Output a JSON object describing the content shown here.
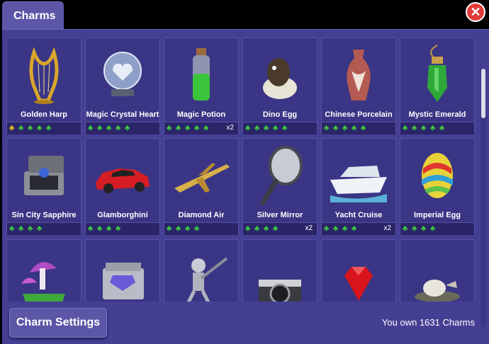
{
  "header": {
    "tab_label": "Charms",
    "close_icon": "close-icon"
  },
  "charms": [
    {
      "name": "Golden Harp",
      "clovers": 5,
      "gold": 1,
      "mult": ""
    },
    {
      "name": "Magic Crystal Heart",
      "clovers": 5,
      "gold": 0,
      "mult": ""
    },
    {
      "name": "Magic Potion",
      "clovers": 5,
      "gold": 0,
      "mult": "x2"
    },
    {
      "name": "Dino Egg",
      "clovers": 5,
      "gold": 0,
      "mult": ""
    },
    {
      "name": "Chinese Porcelain",
      "clovers": 5,
      "gold": 0,
      "mult": ""
    },
    {
      "name": "Mystic Emerald",
      "clovers": 5,
      "gold": 0,
      "mult": ""
    },
    {
      "name": "Sin City Sapphire",
      "clovers": 4,
      "gold": 0,
      "mult": ""
    },
    {
      "name": "Glamborghini",
      "clovers": 4,
      "gold": 0,
      "mult": ""
    },
    {
      "name": "Diamond Air",
      "clovers": 4,
      "gold": 0,
      "mult": ""
    },
    {
      "name": "Silver Mirror",
      "clovers": 4,
      "gold": 0,
      "mult": "x2"
    },
    {
      "name": "Yacht Cruise",
      "clovers": 4,
      "gold": 0,
      "mult": "x2"
    },
    {
      "name": "Imperial Egg",
      "clovers": 4,
      "gold": 0,
      "mult": ""
    },
    {
      "name": "",
      "clovers": 0,
      "gold": 0,
      "mult": ""
    },
    {
      "name": "",
      "clovers": 0,
      "gold": 0,
      "mult": ""
    },
    {
      "name": "",
      "clovers": 0,
      "gold": 0,
      "mult": ""
    },
    {
      "name": "",
      "clovers": 0,
      "gold": 0,
      "mult": ""
    },
    {
      "name": "",
      "clovers": 0,
      "gold": 0,
      "mult": ""
    },
    {
      "name": "",
      "clovers": 0,
      "gold": 0,
      "mult": ""
    }
  ],
  "footer": {
    "settings_label": "Charm Settings",
    "owned_text": "You own 1631 Charms"
  }
}
